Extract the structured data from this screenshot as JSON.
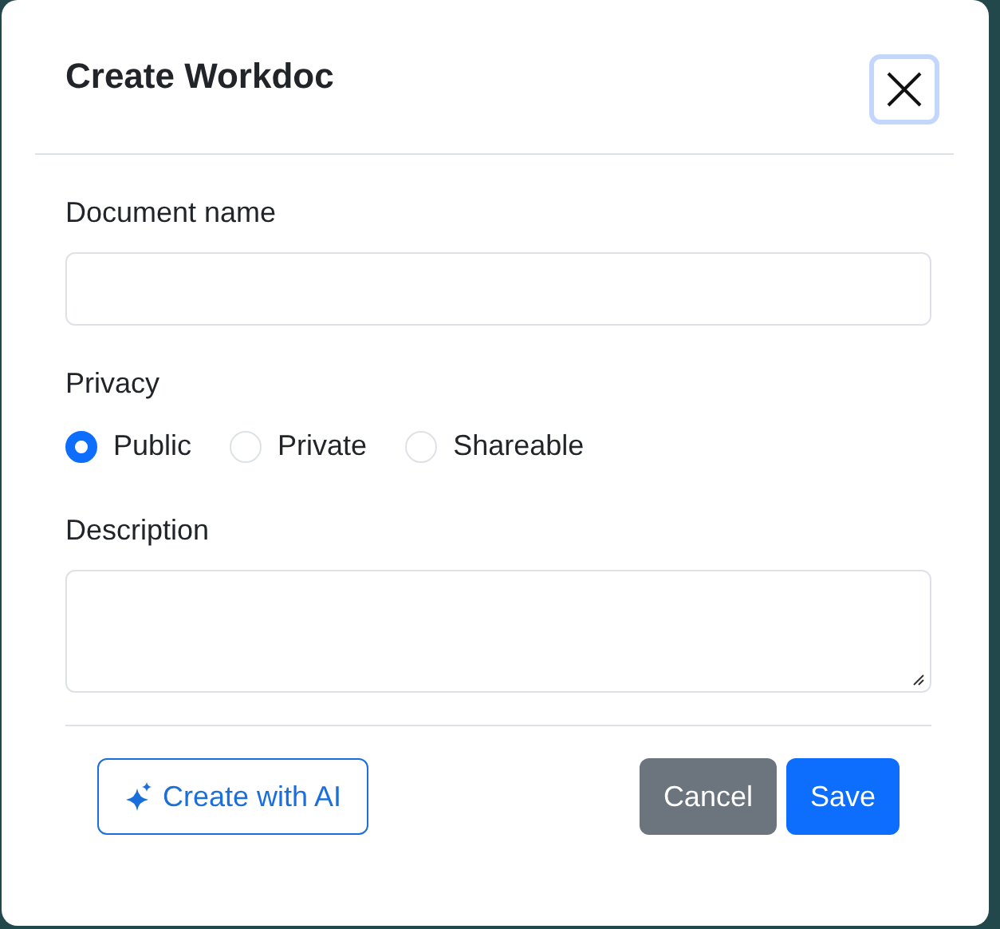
{
  "dialog": {
    "title": "Create Workdoc"
  },
  "fields": [
    {
      "kind": "input",
      "label": "Document name"
    },
    {
      "kind": "radios",
      "label": "Privacy",
      "options": [
        {
          "label": "Public",
          "selected": true
        },
        {
          "label": "Private",
          "selected": false
        },
        {
          "label": "Shareable",
          "selected": false
        }
      ]
    },
    {
      "kind": "textarea",
      "label": "Description"
    }
  ],
  "ai_button": {
    "label": "Create with AI"
  },
  "buttons": [
    {
      "kind": "secondary",
      "label": "Cancel"
    },
    {
      "kind": "primary",
      "label": "Save"
    }
  ]
}
